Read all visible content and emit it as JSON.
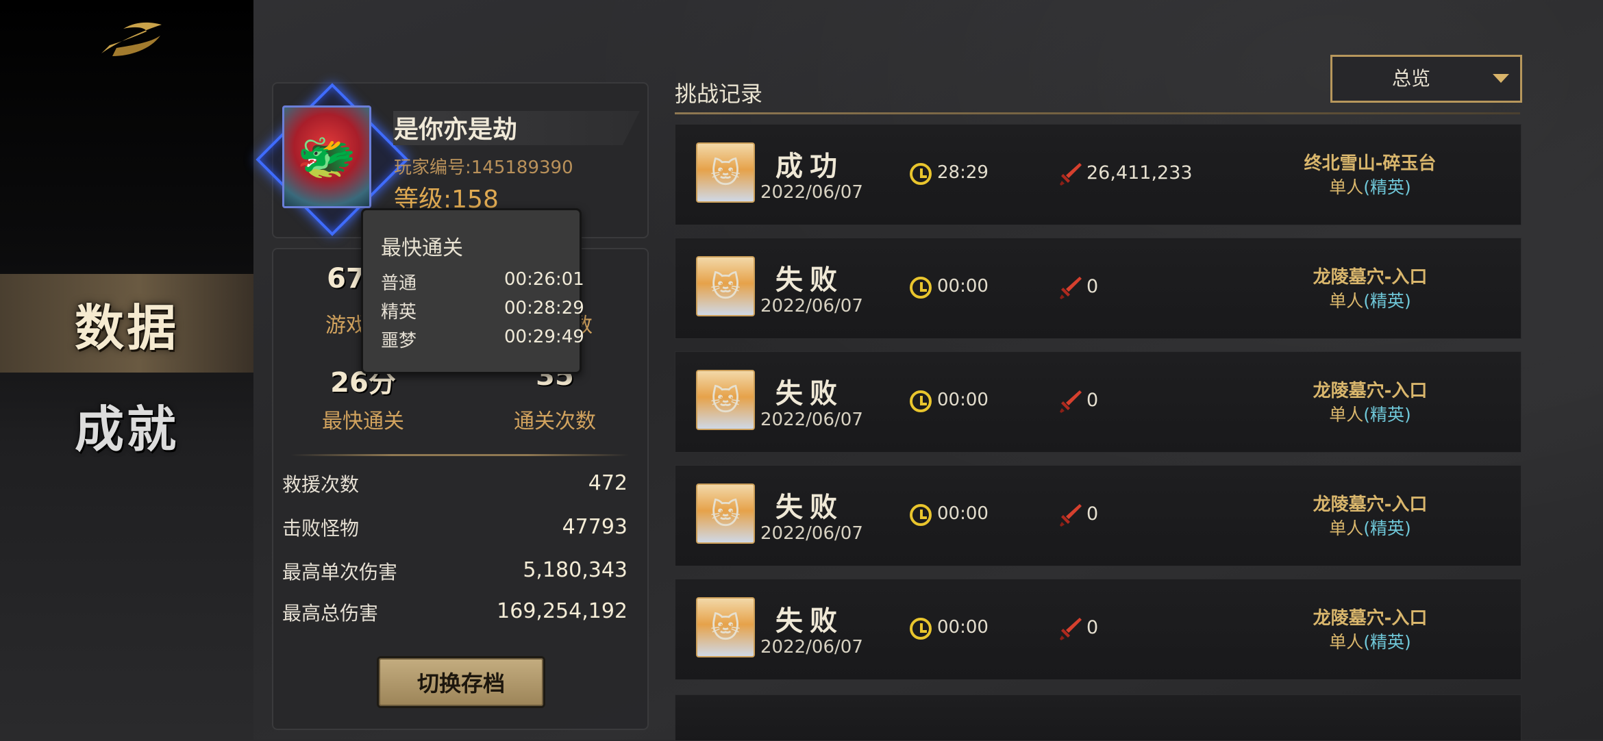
{
  "sidebar": {
    "items": [
      {
        "label": "数据",
        "active": true
      },
      {
        "label": "成就",
        "active": false
      }
    ]
  },
  "profile": {
    "name": "是你亦是劫",
    "player_id": "玩家编号:145189390",
    "level": "等级:158"
  },
  "stats": {
    "games_value": "67",
    "games_label": "游戏",
    "hidden_label": "数",
    "fastest_value": "26分",
    "fastest_label": "最快通关",
    "clears_value": "35",
    "clears_label": "通关次数",
    "rows": [
      {
        "label": "救援次数",
        "value": "472"
      },
      {
        "label": "击败怪物",
        "value": "47793"
      },
      {
        "label": "最高单次伤害",
        "value": "5,180,343"
      },
      {
        "label": "最高总伤害",
        "value": "169,254,192"
      }
    ],
    "switch_button": "切换存档"
  },
  "tooltip": {
    "title": "最快通关",
    "rows": [
      {
        "label": "普通",
        "time": "00:26:01"
      },
      {
        "label": "精英",
        "time": "00:28:29"
      },
      {
        "label": "噩梦",
        "time": "00:29:49"
      }
    ]
  },
  "records": {
    "title": "挑战记录",
    "filter": "总览",
    "items": [
      {
        "result": "成功",
        "date": "2022/06/07",
        "time": "28:29",
        "damage": "26,411,233",
        "map": "终北雪山-碎玉台",
        "mode": "单人",
        "difficulty": "(精英)"
      },
      {
        "result": "失败",
        "date": "2022/06/07",
        "time": "00:00",
        "damage": "0",
        "map": "龙陵墓穴-入口",
        "mode": "单人",
        "difficulty": "(精英)"
      },
      {
        "result": "失败",
        "date": "2022/06/07",
        "time": "00:00",
        "damage": "0",
        "map": "龙陵墓穴-入口",
        "mode": "单人",
        "difficulty": "(精英)"
      },
      {
        "result": "失败",
        "date": "2022/06/07",
        "time": "00:00",
        "damage": "0",
        "map": "龙陵墓穴-入口",
        "mode": "单人",
        "difficulty": "(精英)"
      },
      {
        "result": "失败",
        "date": "2022/06/07",
        "time": "00:00",
        "damage": "0",
        "map": "龙陵墓穴-入口",
        "mode": "单人",
        "difficulty": "(精英)"
      }
    ]
  },
  "colors": {
    "accent_gold": "#d9b66c",
    "elite_cyan": "#6fc7d8",
    "clock_yellow": "#e9c52d",
    "frame_blue": "#3f6cff"
  }
}
